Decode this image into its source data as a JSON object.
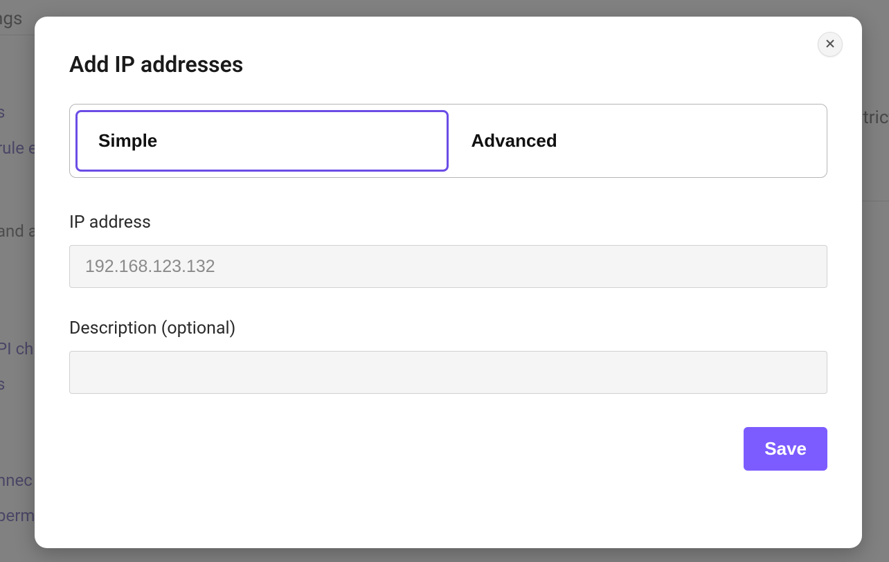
{
  "background": {
    "top_text": "ngs",
    "link1": "s",
    "link2": "rule e",
    "gray1": "and ac",
    "link3": "PI ch",
    "link4": "s",
    "link5": "nnec",
    "link6": "perm",
    "right1": "trict"
  },
  "modal": {
    "title": "Add IP addresses",
    "tabs": {
      "simple": "Simple",
      "advanced": "Advanced"
    },
    "ip_label": "IP address",
    "ip_placeholder": "192.168.123.132",
    "ip_value": "",
    "description_label": "Description (optional)",
    "description_value": "",
    "save_label": "Save"
  }
}
